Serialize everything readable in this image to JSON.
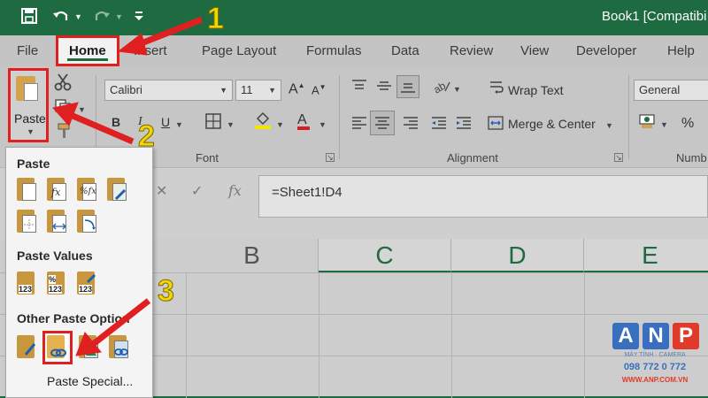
{
  "window": {
    "title": "Book1  [Compatibi",
    "colors": {
      "title_bar": "#1e6b41",
      "annotation_red": "#e02020",
      "annotation_yellow": "#f2d600"
    }
  },
  "quick_access": {
    "icons": [
      "save-icon",
      "undo-icon",
      "redo-icon",
      "customize-qat-icon"
    ]
  },
  "tabs": [
    {
      "label": "File"
    },
    {
      "label": "Home",
      "active": true
    },
    {
      "label": "Insert"
    },
    {
      "label": "Page Layout"
    },
    {
      "label": "Formulas"
    },
    {
      "label": "Data"
    },
    {
      "label": "Review"
    },
    {
      "label": "View"
    },
    {
      "label": "Developer"
    },
    {
      "label": "Help"
    }
  ],
  "ribbon": {
    "clipboard": {
      "paste_label": "Paste"
    },
    "font": {
      "font_name": "Calibri",
      "font_size": "11",
      "group_label": "Font",
      "bold": "B",
      "italic": "I",
      "underline": "U",
      "grow": "A",
      "shrink": "A",
      "font_color": "A"
    },
    "alignment": {
      "wrap_text": "Wrap Text",
      "merge_center": "Merge & Center",
      "group_label": "Alignment"
    },
    "number": {
      "format": "General",
      "percent": "%",
      "group_label": "Numb"
    }
  },
  "formula_bar": {
    "fx": "fx",
    "value": "=Sheet1!D4"
  },
  "columns": [
    {
      "label": "B",
      "selected": false
    },
    {
      "label": "C",
      "selected": true
    },
    {
      "label": "D",
      "selected": true
    },
    {
      "label": "E",
      "selected": true
    }
  ],
  "paste_menu": {
    "section_paste": "Paste",
    "section_values": "Paste Values",
    "section_other": "Other Paste Option",
    "paste_special": "Paste Special...",
    "paste_icons": [
      "paste-icon",
      "paste-formulas-icon",
      "paste-formulas-number-format-icon",
      "keep-source-formatting-icon",
      "no-borders-icon",
      "keep-column-widths-icon",
      "transpose-icon"
    ],
    "value_icons": [
      {
        "name": "paste-values-icon",
        "text": "123"
      },
      {
        "name": "values-number-format-icon",
        "text": "123"
      },
      {
        "name": "values-source-formatting-icon",
        "text": "123"
      }
    ],
    "other_icons": [
      "formatting-icon",
      "paste-link-icon",
      "picture-icon",
      "linked-picture-icon"
    ]
  },
  "annotations": [
    "1",
    "2",
    "3"
  ],
  "watermark": {
    "letters": [
      {
        "char": "A",
        "color": "#3a6fbf"
      },
      {
        "char": "N",
        "color": "#3a6fbf"
      },
      {
        "char": "P",
        "color": "#e03a2a"
      }
    ],
    "tagline": "MÁY TÍNH · CAMERA",
    "phone": "098 772 0 772",
    "site": "WWW.ANP.COM.VN"
  }
}
